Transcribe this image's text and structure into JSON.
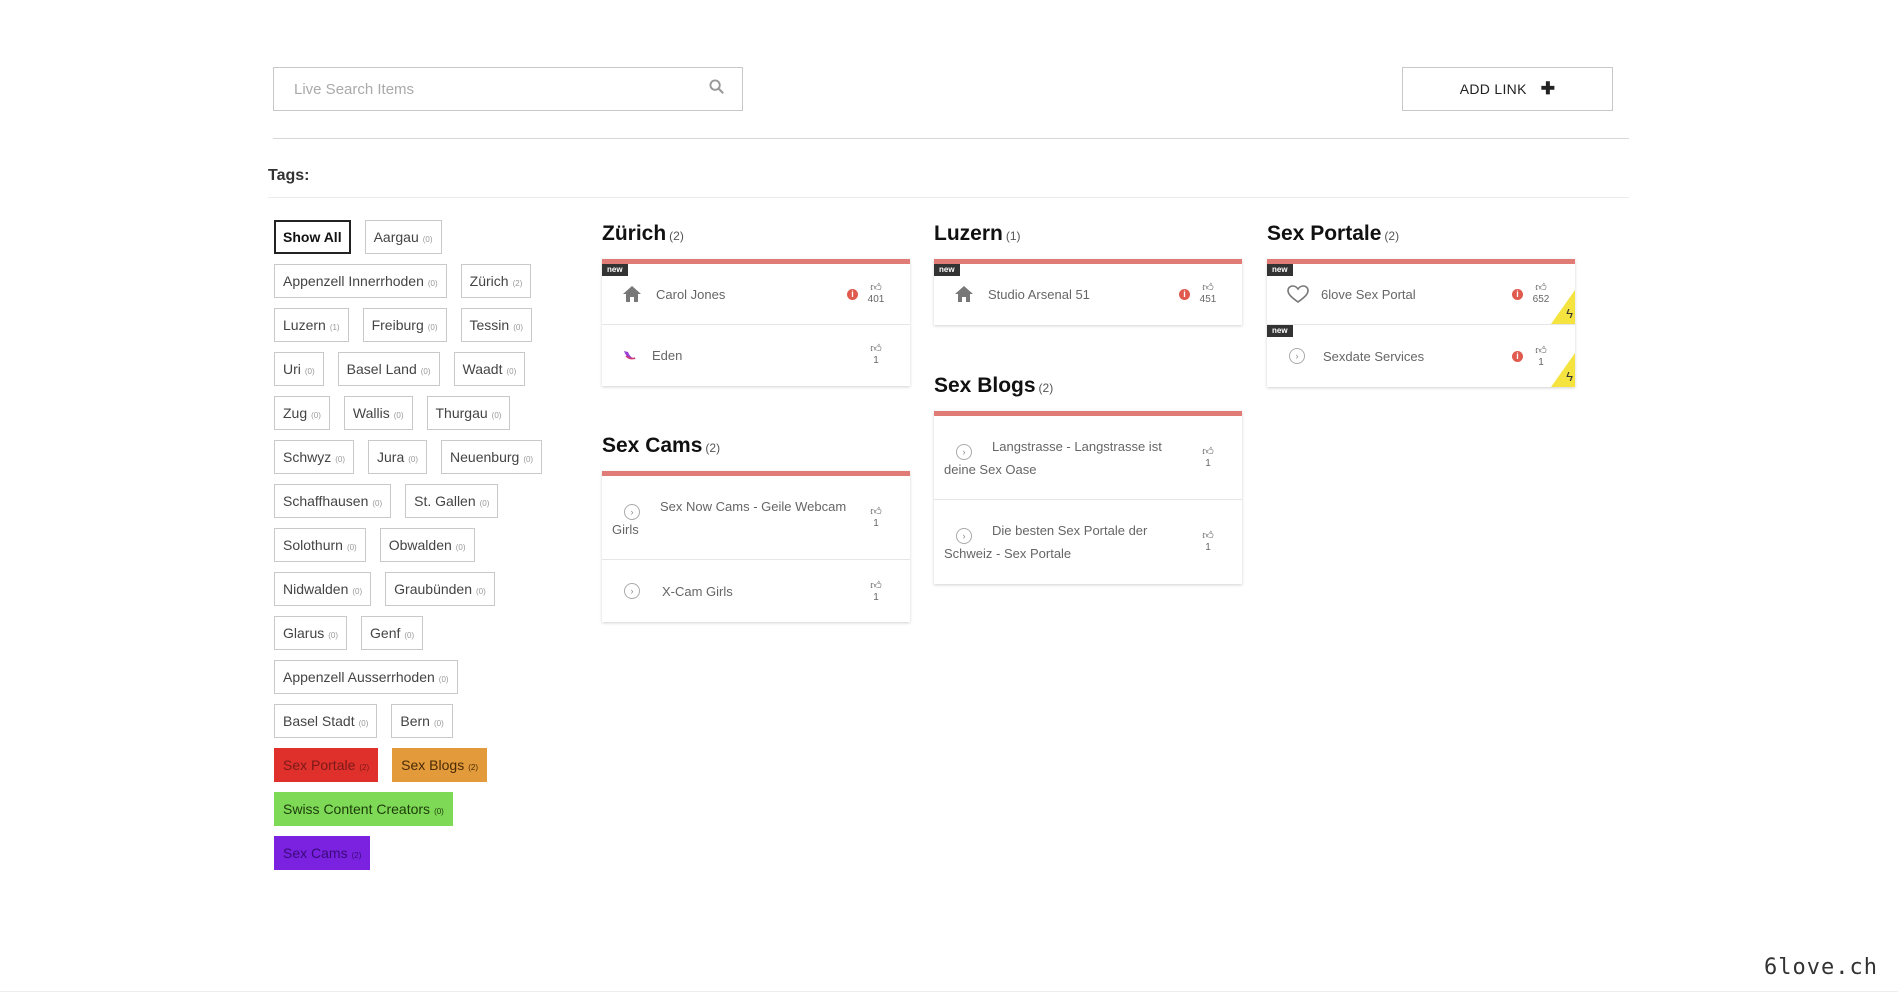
{
  "search": {
    "placeholder": "Live Search Items"
  },
  "add_link": {
    "label": "ADD LINK",
    "icon": "plus-icon"
  },
  "tags_title": "Tags:",
  "tags": [
    [
      {
        "label": "Show All",
        "count": "",
        "active": true
      },
      {
        "label": "Aargau",
        "count": "(0)"
      }
    ],
    [
      {
        "label": "Appenzell Innerrhoden",
        "count": "(0)"
      },
      {
        "label": "Zürich",
        "count": "(2)"
      }
    ],
    [
      {
        "label": "Luzern",
        "count": "(1)"
      },
      {
        "label": "Freiburg",
        "count": "(0)"
      },
      {
        "label": "Tessin",
        "count": "(0)"
      }
    ],
    [
      {
        "label": "Uri",
        "count": "(0)"
      },
      {
        "label": "Basel Land",
        "count": "(0)"
      },
      {
        "label": "Waadt",
        "count": "(0)"
      }
    ],
    [
      {
        "label": "Zug",
        "count": "(0)"
      },
      {
        "label": "Wallis",
        "count": "(0)"
      },
      {
        "label": "Thurgau",
        "count": "(0)"
      }
    ],
    [
      {
        "label": "Schwyz",
        "count": "(0)"
      },
      {
        "label": "Jura",
        "count": "(0)"
      },
      {
        "label": "Neuenburg",
        "count": "(0)"
      }
    ],
    [
      {
        "label": "Schaffhausen",
        "count": "(0)"
      },
      {
        "label": "St. Gallen",
        "count": "(0)"
      }
    ],
    [
      {
        "label": "Solothurn",
        "count": "(0)"
      },
      {
        "label": "Obwalden",
        "count": "(0)"
      }
    ],
    [
      {
        "label": "Nidwalden",
        "count": "(0)"
      },
      {
        "label": "Graubünden",
        "count": "(0)"
      }
    ],
    [
      {
        "label": "Glarus",
        "count": "(0)"
      },
      {
        "label": "Genf",
        "count": "(0)"
      }
    ],
    [
      {
        "label": "Appenzell Ausserrhoden",
        "count": "(0)"
      }
    ],
    [
      {
        "label": "Basel Stadt",
        "count": "(0)"
      },
      {
        "label": "Bern",
        "count": "(0)"
      }
    ],
    [
      {
        "label": "Sex Portale",
        "count": "(2)",
        "bg": "#e0302c",
        "color": "#7a1a18"
      },
      {
        "label": "Sex Blogs",
        "count": "(2)",
        "bg": "#e39a3a",
        "color": "#4a2a05"
      }
    ],
    [
      {
        "label": "Swiss Content Creators",
        "count": "(0)",
        "bg": "#7ed957",
        "color": "#1c3c0a"
      }
    ],
    [
      {
        "label": "Sex Cams",
        "count": "(2)",
        "bg": "#7a22e0",
        "color": "#3a0a7a"
      }
    ]
  ],
  "sections": {
    "zurich": {
      "title": "Zürich",
      "count": "(2)",
      "items": [
        {
          "title": "Carol Jones",
          "votes": "401",
          "new": "new",
          "info": "i",
          "icon": "house-icon"
        },
        {
          "title": "Eden",
          "votes": "1",
          "icon": "logo-icon"
        }
      ]
    },
    "sexcams": {
      "title": "Sex Cams",
      "count": "(2)",
      "items": [
        {
          "title": "Sex Now Cams - Geile Webcam Girls",
          "votes": "1",
          "icon": "circle-arrow-icon"
        },
        {
          "title": "X-Cam Girls",
          "votes": "1",
          "icon": "circle-arrow-icon"
        }
      ]
    },
    "luzern": {
      "title": "Luzern",
      "count": "(1)",
      "items": [
        {
          "title": "Studio Arsenal 51",
          "votes": "451",
          "new": "new",
          "info": "i",
          "icon": "house-icon"
        }
      ]
    },
    "sexblogs": {
      "title": "Sex Blogs",
      "count": "(2)",
      "items": [
        {
          "title": "Langstrasse - Langstrasse ist deine Sex Oase",
          "votes": "1",
          "icon": "circle-arrow-icon"
        },
        {
          "title": "Die besten Sex Portale der Schweiz - Sex Portale",
          "votes": "1",
          "icon": "circle-arrow-icon"
        }
      ]
    },
    "sexportale": {
      "title": "Sex Portale",
      "count": "(2)",
      "items": [
        {
          "title": "6love Sex Portal",
          "votes": "652",
          "new": "new",
          "info": "i",
          "icon": "heart-icon"
        },
        {
          "title": "Sexdate Services",
          "votes": "1",
          "new": "new",
          "info": "i",
          "icon": "circle-arrow-icon"
        }
      ]
    }
  },
  "watermark": "6love.ch",
  "colors": {
    "card_accent": "#e07b75",
    "info_red": "#e05a4e",
    "bolt_yellow": "#f5e340",
    "badge_dark": "#333333"
  }
}
